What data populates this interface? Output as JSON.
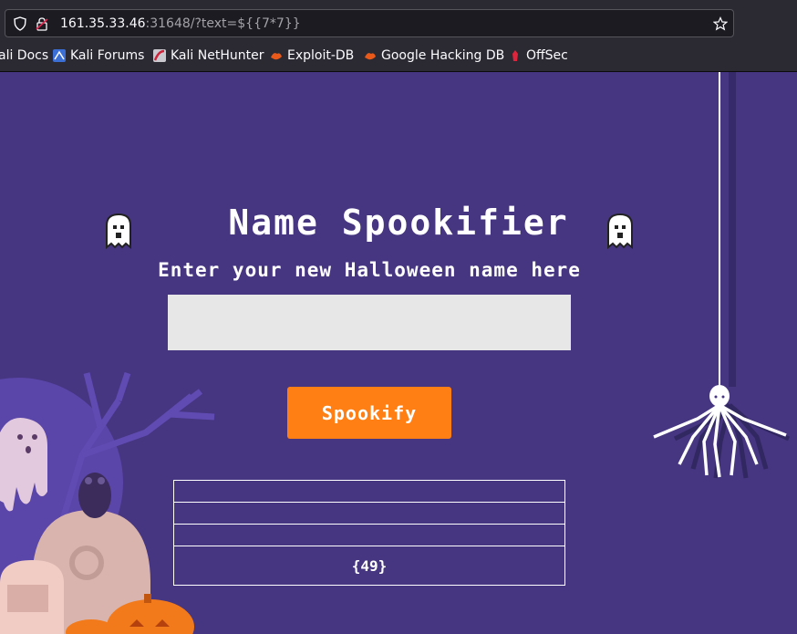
{
  "browser": {
    "url_host": "161.35.33.46",
    "url_rest": ":31648/?text=${{7*7}}",
    "bookmarks": [
      "ali Docs",
      "Kali Forums",
      "Kali NetHunter",
      "Exploit-DB",
      "Google Hacking DB",
      "OffSec"
    ]
  },
  "page": {
    "title": "Name Spookifier",
    "subtitle": "Enter your new Halloween name here",
    "input_value": "",
    "button_label": "Spookify",
    "results": [
      "",
      "",
      "",
      "{49}"
    ]
  },
  "colors": {
    "background": "#463580",
    "button": "#ff7f14",
    "input": "#e7e7e7"
  }
}
